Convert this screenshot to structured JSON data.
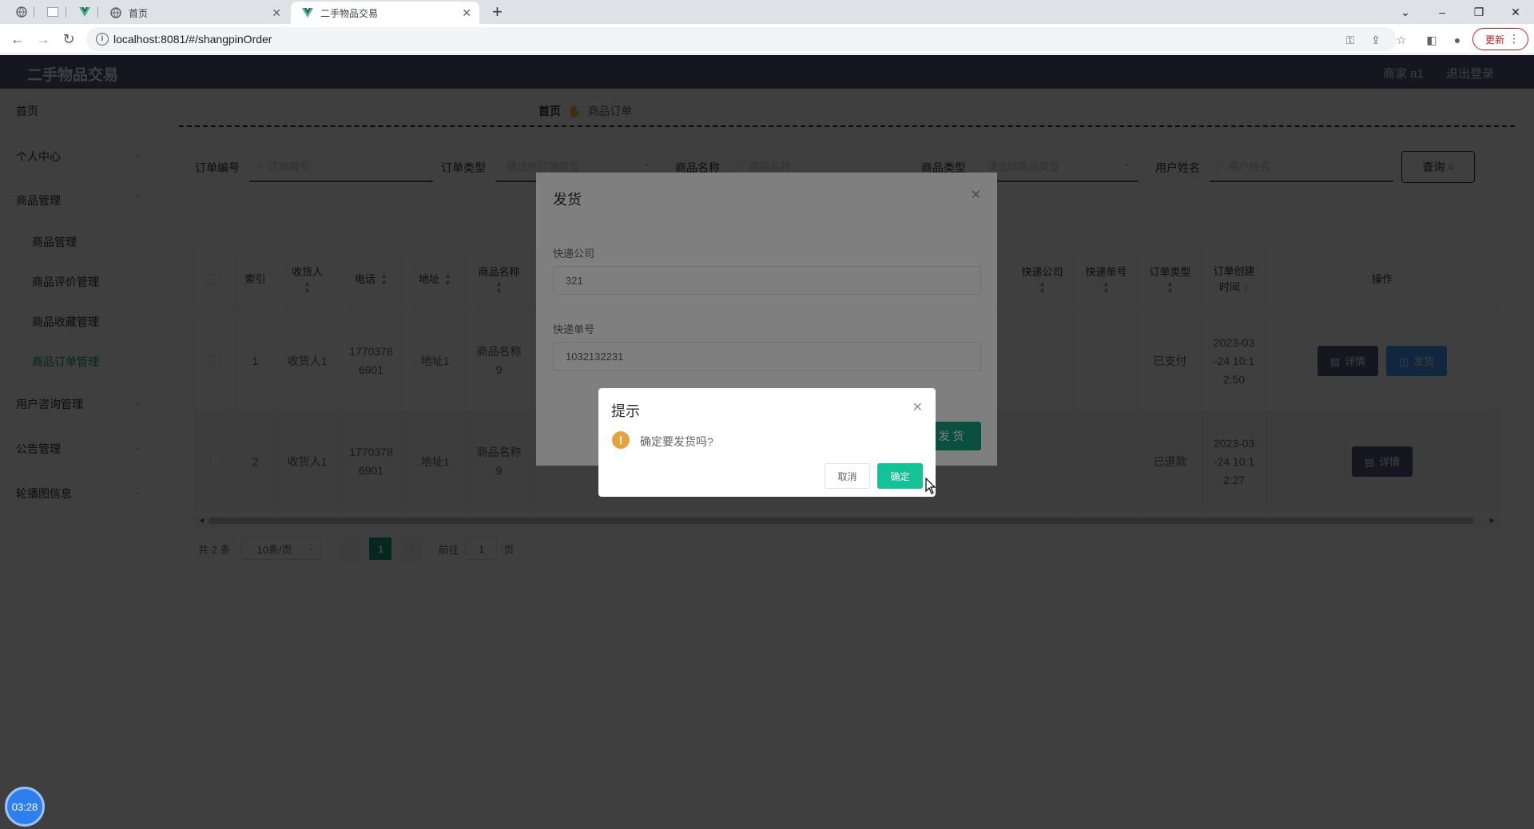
{
  "browser": {
    "tabs": [
      {
        "title": "首页"
      },
      {
        "title": "二手物品交易"
      }
    ],
    "url": "localhost:8081/#/shangpinOrder",
    "update_label": "更新"
  },
  "app": {
    "brand": "二手物品交易",
    "user_label": "商家 a1",
    "logout_label": "退出登录"
  },
  "sidebar": {
    "items": [
      {
        "label": "首页"
      },
      {
        "label": "个人中心"
      },
      {
        "label": "商品管理"
      },
      {
        "label": "商品管理"
      },
      {
        "label": "商品评价管理"
      },
      {
        "label": "商品收藏管理"
      },
      {
        "label": "商品订单管理"
      },
      {
        "label": "用户咨询管理"
      },
      {
        "label": "公告管理"
      },
      {
        "label": "轮播图信息"
      }
    ]
  },
  "breadcrumb": {
    "home": "首页",
    "current": "商品订单"
  },
  "search": {
    "order_no_label": "订单编号",
    "order_no_placeholder": "订单编号",
    "order_type_label": "订单类型",
    "order_type_placeholder": "请选择订单类型",
    "product_name_label": "商品名称",
    "product_name_placeholder": "商品名称",
    "product_type_label": "商品类型",
    "product_type_placeholder": "请选择商品类型",
    "user_name_label": "用户姓名",
    "user_name_placeholder": "用户姓名",
    "query_label": "查询"
  },
  "table": {
    "headers": {
      "index": "索引",
      "receiver": "收货人",
      "phone": "电话",
      "address": "地址",
      "product_name": "商品名称",
      "express_company": "快递公司",
      "express_no": "快递单号",
      "order_type": "订单类型",
      "created_1": "订单创建",
      "created_2": "时间",
      "ops": "操作"
    },
    "rows": [
      {
        "index": "1",
        "receiver": "收货人1",
        "phone_1": "1770378",
        "phone_2": "6901",
        "address": "地址1",
        "product_1": "商品名称",
        "product_2": "9",
        "order_type": "已支付",
        "time_1": "2023-03",
        "time_2": "-24 10:1",
        "time_3": "2:50",
        "detail": "详情",
        "ship": "发货"
      },
      {
        "index": "2",
        "receiver": "收货人1",
        "phone_1": "1770378",
        "phone_2": "6901",
        "address": "地址1",
        "product_1": "商品名称",
        "product_2": "9",
        "order_type": "已退款",
        "time_1": "2023-03",
        "time_2": "-24 10:1",
        "time_3": "2:27",
        "detail": "详情"
      }
    ]
  },
  "pager": {
    "total": "共 2 条",
    "size": "10条/页",
    "page": "1",
    "goto": "前往",
    "goto_value": "1",
    "page_suffix": "页"
  },
  "ship_dialog": {
    "title": "发货",
    "company_label": "快递公司",
    "company_value": "321",
    "number_label": "快递单号",
    "number_value": "1032132231",
    "submit_label": "发货"
  },
  "confirm": {
    "title": "提示",
    "message": "确定要发货吗?",
    "cancel_label": "取消",
    "ok_label": "确定"
  },
  "clock": "03:28",
  "colors": {
    "header": "#5a5a86",
    "accent": "#13a183",
    "detail_btn": "#5a5a86",
    "ship_btn": "#409eff",
    "warn": "#e6a23c"
  }
}
